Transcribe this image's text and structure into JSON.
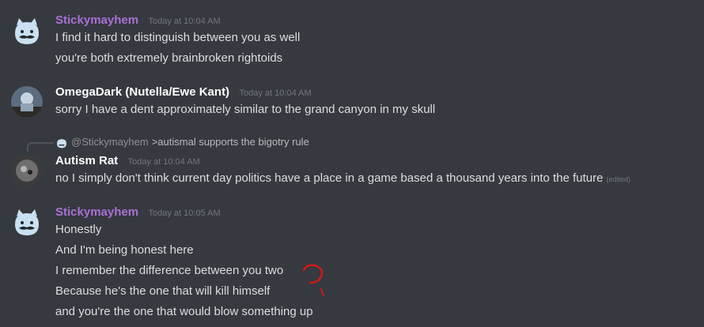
{
  "messages": [
    {
      "author": "Stickymayhem",
      "author_color": "#a970d6",
      "timestamp": "Today at 10:04 AM",
      "lines": [
        "I find it hard to distinguish between you as well",
        "you're both extremely brainbroken rightoids"
      ]
    },
    {
      "author": "OmegaDark (Nutella/Ewe Kant)",
      "author_color": "#ffffff",
      "timestamp": "Today at 10:04 AM",
      "lines": [
        "sorry I have a dent approximately similar to the grand canyon in my skull"
      ]
    },
    {
      "reply": {
        "mention": "@Stickymayhem",
        "text": ">autismal supports the bigotry rule"
      },
      "author": "Autism Rat",
      "author_color": "#ffffff",
      "timestamp": "Today at 10:04 AM",
      "lines": [
        "no I simply don't think current day politics have a place in a game based a thousand years into the future"
      ],
      "edited_label": "(edited)"
    },
    {
      "author": "Stickymayhem",
      "author_color": "#a970d6",
      "timestamp": "Today at 10:05 AM",
      "lines": [
        "Honestly",
        "And I'm being honest here",
        "I remember the difference between you two",
        "Because he's the one that will kill himself",
        "and you're the one that would blow something up"
      ]
    }
  ],
  "colors": {
    "background": "#36393f",
    "message_text": "#dcddde",
    "timestamp": "#72767d",
    "scribble": "#d21919"
  },
  "icons": {
    "avatar_1": "blue-cat-mustache-avatar",
    "avatar_2": "photo-avatar",
    "avatar_3": "photo-avatar",
    "scribble": "hand-drawn-question-mark"
  }
}
